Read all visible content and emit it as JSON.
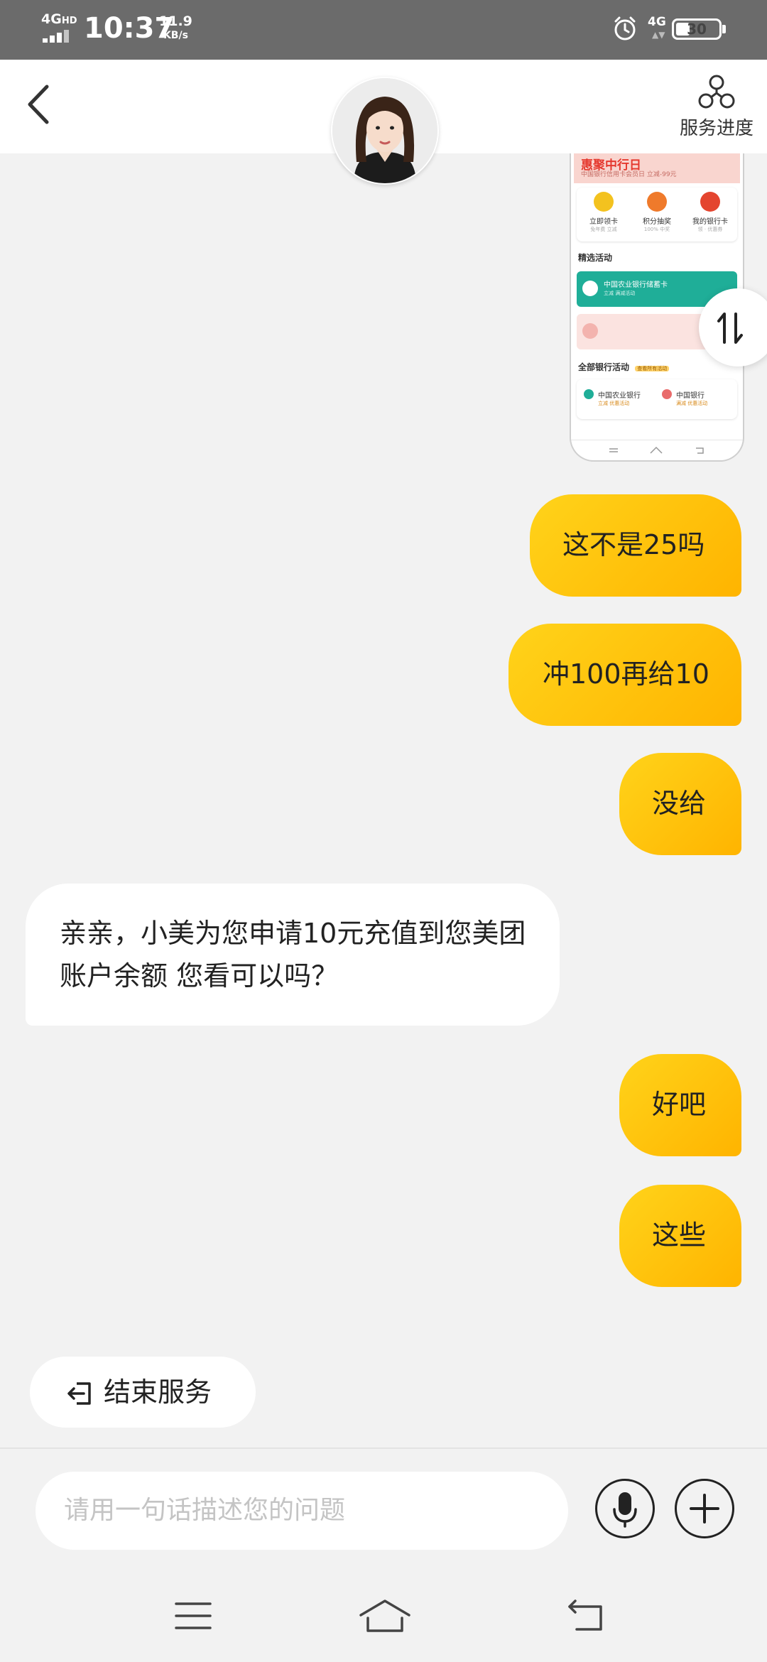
{
  "status_bar": {
    "network": "4G",
    "network_hd": "HD",
    "time": "10:37",
    "speed_value": "11.9",
    "speed_unit": "KB/s",
    "cell": "4G",
    "battery": "30"
  },
  "header": {
    "service_progress_label": "服务进度"
  },
  "screenshot": {
    "title": "惠聚中行日",
    "subtitle": "中国银行信用卡会员日 立减-99元",
    "tiles": [
      {
        "label": "立即领卡",
        "sub": "免年费 立减",
        "color": "#f3c21f"
      },
      {
        "label": "积分抽奖",
        "sub": "100% 中奖",
        "color": "#ef7a2b"
      },
      {
        "label": "我的银行卡",
        "sub": "领 · 优惠券",
        "color": "#e4452f"
      }
    ],
    "section_featured": "精选活动",
    "featured_title": "中国农业银行储蓄卡",
    "featured_sub": "立减 满减活动",
    "section_all": "全部银行活动",
    "all_badge": "查看所有活动",
    "banks": [
      {
        "name": "中国农业银行",
        "sub": "立减 优惠活动"
      },
      {
        "name": "中国银行",
        "sub": "满减 优惠活动"
      }
    ]
  },
  "messages": [
    {
      "dir": "out",
      "text": "这不是25吗"
    },
    {
      "dir": "out",
      "text": "冲100再给10"
    },
    {
      "dir": "out",
      "text": "没给"
    },
    {
      "dir": "in",
      "text": "亲亲，小美为您申请10元充值到您美团账户余额  您看可以吗？"
    },
    {
      "dir": "out",
      "text": "好吧"
    },
    {
      "dir": "out",
      "text": "这些"
    }
  ],
  "end_service_label": "结束服务",
  "input": {
    "placeholder": "请用一句话描述您的问题"
  },
  "colors": {
    "bubble_out": "#ffc30b",
    "bubble_in": "#ffffff",
    "background": "#f2f2f2",
    "status_bar": "#6b6b6b"
  },
  "icons": [
    "back-icon",
    "service-progress-icon",
    "swap-icon",
    "end-service-icon",
    "microphone-icon",
    "plus-icon",
    "menu-icon",
    "home-icon",
    "return-icon"
  ]
}
